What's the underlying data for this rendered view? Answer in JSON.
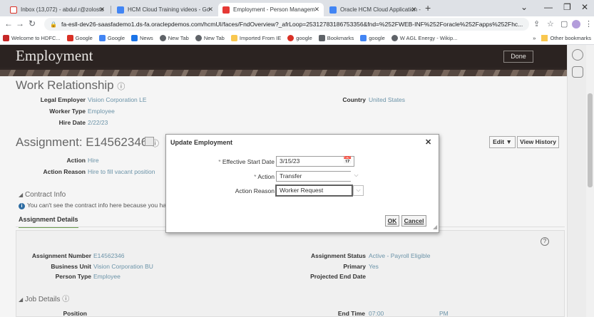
{
  "browser": {
    "tabs": [
      {
        "title": "Inbox (13,072) - abdul.r@zoloste",
        "icon_color": "#d93025",
        "icon": "gmail-icon"
      },
      {
        "title": "HCM Cloud Training videos - Go",
        "icon_color": "#4285f4",
        "icon": "docs-icon"
      },
      {
        "title": "Employment - Person Managem",
        "icon_color": "#e53935",
        "icon": "oracle-icon"
      },
      {
        "title": "Oracle HCM Cloud Application - ",
        "icon_color": "#4285f4",
        "icon": "docs-icon"
      }
    ],
    "url": "fa-esll-dev26-saasfademo1.ds-fa.oraclepdemos.com/hcmUI/faces/FndOverview?_afrLoop=25312783186753356&fnd=%252FWEB-INF%252Foracle%252Fapps%252Fhc...",
    "bookmarks": [
      {
        "label": "Welcome to HDFC...",
        "color": "#c62828"
      },
      {
        "label": "Google",
        "color": "#d93025"
      },
      {
        "label": "Google",
        "color": "#4285f4"
      },
      {
        "label": "News",
        "color": "#1a73e8"
      },
      {
        "label": "New Tab",
        "color": "#5f6368"
      },
      {
        "label": "New Tab",
        "color": "#5f6368"
      },
      {
        "label": "Imported From IE",
        "color": "#f9c74f"
      },
      {
        "label": "google",
        "color": "#d93025"
      },
      {
        "label": "Bookmarks",
        "color": "#5f6368"
      },
      {
        "label": "google",
        "color": "#4285f4"
      },
      {
        "label": "W AGL Energy - Wikip...",
        "color": "#5f6368"
      }
    ],
    "other_bookmarks": "Other bookmarks",
    "more": "»"
  },
  "page": {
    "title": "Employment",
    "done": "Done",
    "work_relationship": {
      "heading": "Work Relationship",
      "legal_employer_label": "Legal Employer",
      "legal_employer": "Vision Corporation LE",
      "worker_type_label": "Worker Type",
      "worker_type": "Employee",
      "hire_date_label": "Hire Date",
      "hire_date": "2/22/23",
      "country_label": "Country",
      "country": "United States"
    },
    "assignment": {
      "heading": "Assignment: E14562346",
      "action_label": "Action",
      "action": "Hire",
      "action_reason_label": "Action Reason",
      "action_reason": "Hire to fill vacant position",
      "edit": "Edit ▼",
      "view_history": "View History"
    },
    "contract_info": "Contract Info",
    "contract_note": "You can't see the contract info here because you ha",
    "assignment_details_tab": "Assignment Details",
    "details": {
      "assignment_number_label": "Assignment Number",
      "assignment_number": "E14562346",
      "business_unit_label": "Business Unit",
      "business_unit": "Vision Corporation BU",
      "person_type_label": "Person Type",
      "person_type": "Employee",
      "assignment_status_label": "Assignment Status",
      "assignment_status": "Active - Payroll Eligible",
      "primary_label": "Primary",
      "primary": "Yes",
      "projected_end_date_label": "Projected End Date"
    },
    "job_details": "Job Details",
    "position_label": "Position",
    "end_time_label": "End Time",
    "end_time": "07:00",
    "end_time_ampm": "PM"
  },
  "dialog": {
    "title": "Update Employment",
    "effective_start_date_label": "Effective Start Date",
    "effective_start_date": "3/15/23",
    "action_label": "Action",
    "action": "Transfer",
    "action_reason_label": "Action Reason",
    "action_reason": "Worker Request",
    "ok": "OK",
    "cancel": "Cancel"
  }
}
